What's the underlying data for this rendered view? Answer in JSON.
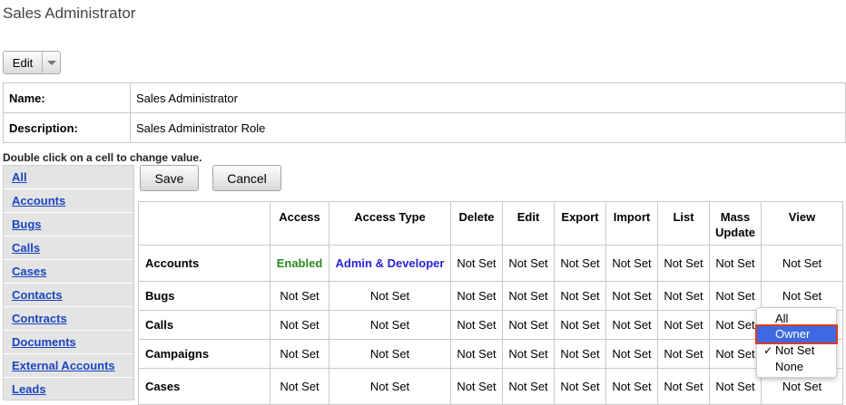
{
  "page": {
    "title": "Sales Administrator"
  },
  "toolbar": {
    "edit_label": "Edit"
  },
  "details": {
    "name_label": "Name:",
    "name_value": "Sales Administrator",
    "description_label": "Description:",
    "description_value": "Sales Administrator Role"
  },
  "hint": "Double click on a cell to change value.",
  "sidebar": {
    "items": [
      "All",
      "Accounts",
      "Bugs",
      "Calls",
      "Cases",
      "Contacts",
      "Contracts",
      "Documents",
      "External Accounts",
      "Leads"
    ]
  },
  "actions": {
    "save_label": "Save",
    "cancel_label": "Cancel"
  },
  "grid": {
    "headers": [
      "",
      "Access",
      "Access Type",
      "Delete",
      "Edit",
      "Export",
      "Import",
      "List",
      "Mass Update",
      "View"
    ],
    "rows": [
      {
        "name": "Accounts",
        "cells": [
          "Enabled",
          "Admin & Developer",
          "Not Set",
          "Not Set",
          "Not Set",
          "Not Set",
          "Not Set",
          "Not Set",
          "Not Set"
        ]
      },
      {
        "name": "Bugs",
        "cells": [
          "Not Set",
          "Not Set",
          "Not Set",
          "Not Set",
          "Not Set",
          "Not Set",
          "Not Set",
          "Not Set",
          "Not Set"
        ]
      },
      {
        "name": "Calls",
        "cells": [
          "Not Set",
          "Not Set",
          "Not Set",
          "Not Set",
          "Not Set",
          "Not Set",
          "Not Set",
          "Not Set",
          ""
        ]
      },
      {
        "name": "Campaigns",
        "cells": [
          "Not Set",
          "Not Set",
          "Not Set",
          "Not Set",
          "Not Set",
          "Not Set",
          "Not Set",
          "Not Set",
          ""
        ]
      },
      {
        "name": "Cases",
        "cells": [
          "Not Set",
          "Not Set",
          "Not Set",
          "Not Set",
          "Not Set",
          "Not Set",
          "Not Set",
          "Not Set",
          "Not Set"
        ]
      }
    ]
  },
  "dropdown": {
    "options": [
      "All",
      "Owner",
      "Not Set",
      "None"
    ],
    "selected": "Not Set",
    "highlighted": "Owner",
    "check_mark": "✓"
  },
  "colors": {
    "link": "#1a45c0",
    "enabled": "#2a8a1e",
    "admin": "#2424d8",
    "highlight": "#3d6ae0",
    "focus_outline": "#e03a1f"
  }
}
